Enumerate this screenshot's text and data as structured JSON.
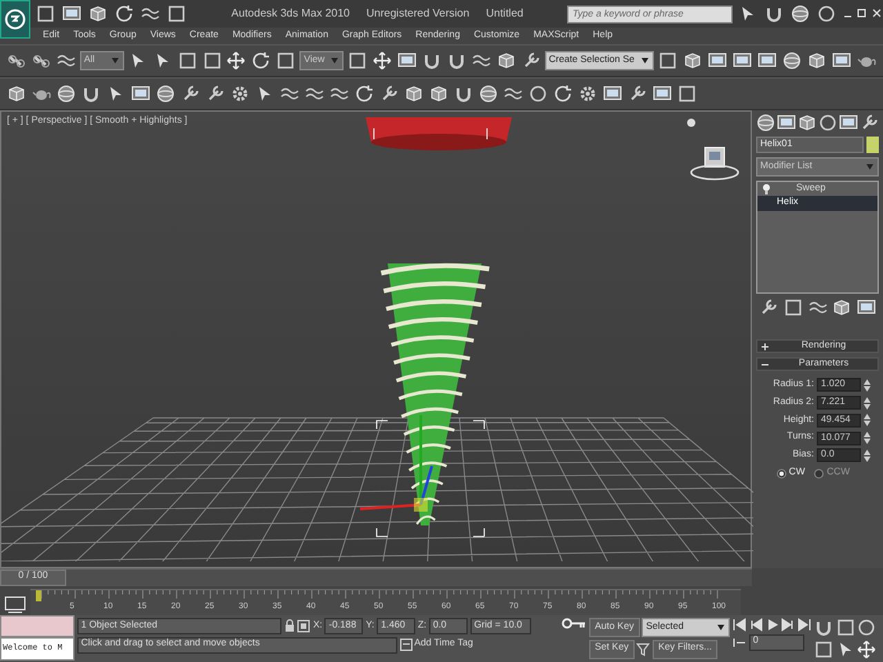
{
  "window": {
    "title": "Autodesk 3ds Max 2010",
    "version_note": "Unregistered Version",
    "document": "Untitled"
  },
  "search": {
    "placeholder": "Type a keyword or phrase"
  },
  "menu": [
    "Edit",
    "Tools",
    "Group",
    "Views",
    "Create",
    "Modifiers",
    "Animation",
    "Graph Editors",
    "Rendering",
    "Customize",
    "MAXScript",
    "Help"
  ],
  "main_toolbar": {
    "selection_filter": "All",
    "reference_coordinate": "View",
    "named_selection": "Create Selection Se"
  },
  "viewport": {
    "label": "[ + ] [ Perspective ] [ Smooth + Highlights ]"
  },
  "command_panel": {
    "object_name": "Helix01",
    "modifier_list": "Modifier List",
    "stack": [
      {
        "label": "Sweep",
        "selected": false
      },
      {
        "label": "Helix",
        "selected": true
      }
    ],
    "rollouts": [
      {
        "title": "Rendering",
        "expanded": false
      },
      {
        "title": "Parameters",
        "expanded": true
      }
    ],
    "parameters": [
      {
        "label": "Radius 1:",
        "value": "1.020"
      },
      {
        "label": "Radius 2:",
        "value": "7.221"
      },
      {
        "label": "Height:",
        "value": "49.454"
      },
      {
        "label": "Turns:",
        "value": "10.077"
      },
      {
        "label": "Bias:",
        "value": "0.0"
      }
    ],
    "direction": [
      {
        "label": "CW",
        "selected": true
      },
      {
        "label": "CCW",
        "selected": false
      }
    ]
  },
  "time_slider": {
    "label": "0 / 100",
    "level": 0
  },
  "track_bar": {
    "ticks": [
      "5",
      "10",
      "15",
      "20",
      "25",
      "30",
      "35",
      "40",
      "45",
      "50",
      "55",
      "60",
      "65",
      "70",
      "75",
      "80",
      "85",
      "90",
      "95",
      "100"
    ]
  },
  "status": {
    "listener_output": "Welcome to M",
    "selection": "1 Object Selected",
    "prompt": "Click and drag to select and move objects",
    "coords": [
      {
        "axis": "X:",
        "value": "-0.188"
      },
      {
        "axis": "Y:",
        "value": "1.460"
      },
      {
        "axis": "Z:",
        "value": "0.0"
      }
    ],
    "grid": "Grid = 10.0",
    "time_tag": "Add Time Tag"
  },
  "animation": {
    "auto_key": "Auto Key",
    "key_mode": "Selected",
    "set_key": "Set Key",
    "key_filters": "Key Filters...",
    "current_frame": "0"
  }
}
